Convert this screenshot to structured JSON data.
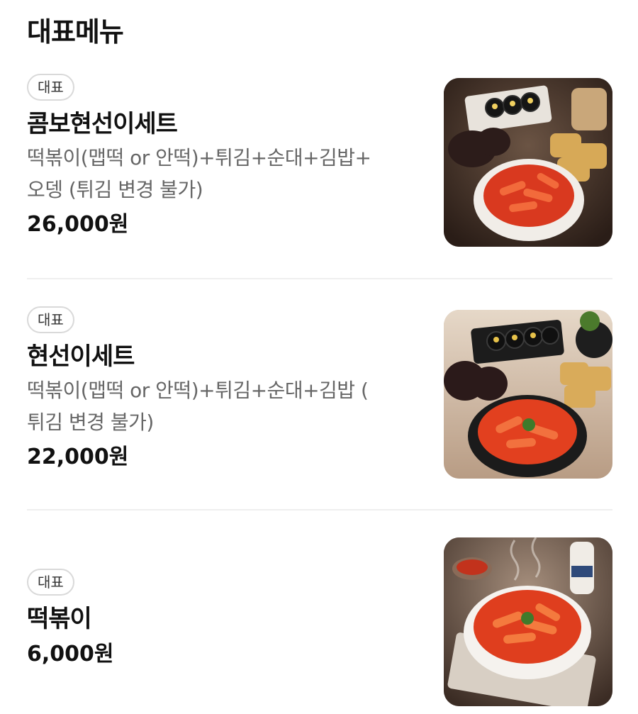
{
  "section": {
    "title": "대표메뉴"
  },
  "items": [
    {
      "badge": "대표",
      "name": "콤보현선이세트",
      "desc_line1": "떡볶이(맵떡 or 안떡)+튀김+순대+김밥+",
      "desc_line2": "오뎅 (튀김 변경 불가)",
      "price": "26,000원",
      "image": "combo-set-photo"
    },
    {
      "badge": "대표",
      "name": "현선이세트",
      "desc_line1": "떡볶이(맵떡 or 안떡)+튀김+순대+김밥 (",
      "desc_line2": "튀김 변경 불가)",
      "price": "22,000원",
      "image": "set-photo"
    },
    {
      "badge": "대표",
      "name": "떡볶이",
      "price": "6,000원",
      "image": "tteokbokki-photo"
    }
  ],
  "colors": {
    "text": "#111111",
    "muted": "#666666",
    "badge_border": "#d9d9d9",
    "divider": "#efefef",
    "sauce": "#e0442a"
  }
}
